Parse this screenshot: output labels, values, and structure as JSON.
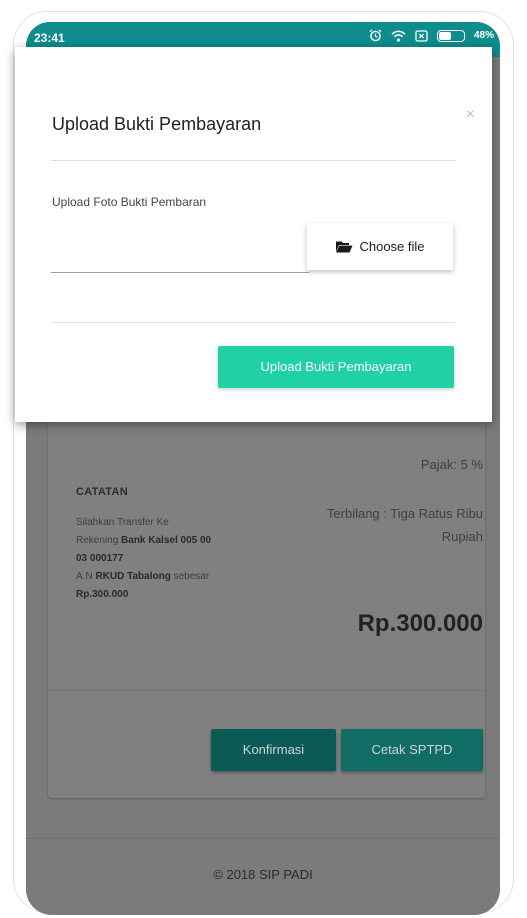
{
  "status_bar": {
    "time": "23:41",
    "battery_percent": "48%",
    "battery_level": 0.48,
    "icons": [
      "alarm-icon",
      "wifi-icon",
      "sim-icon",
      "battery-icon"
    ],
    "color": "#0e8c8e"
  },
  "modal": {
    "title": "Upload Bukti Pembayaran",
    "close_label": "×",
    "field_label": "Upload Foto Bukti Pembaran",
    "file_value": "",
    "choose_file_label": "Choose file",
    "upload_button_label": "Upload Bukti Pembayaran",
    "accent_color": "#1fd1a5"
  },
  "card": {
    "catatan_title": "CATATAN",
    "catatan_lines": [
      {
        "prefix": "Silahkan Transfer Ke",
        "strong": "",
        "suffix": ""
      },
      {
        "prefix": "Rekening ",
        "strong": "Bank Kalsel 005 00",
        "suffix": ""
      },
      {
        "prefix": "",
        "strong": "03 000177",
        "suffix": ""
      },
      {
        "prefix": "A.N ",
        "strong": "RKUD Tabalong",
        "suffix": " sebesar"
      },
      {
        "prefix": "",
        "strong": "Rp.300.000",
        "suffix": ""
      }
    ],
    "pajak": "Pajak: 5 %",
    "terbilang": "Terbilang : Tiga Ratus Ribu Rupiah",
    "total": "Rp.300.000",
    "konfirmasi_label": "Konfirmasi",
    "cetak_label": "Cetak SPTPD"
  },
  "footer": {
    "text": "© 2018 SIP PADI"
  }
}
